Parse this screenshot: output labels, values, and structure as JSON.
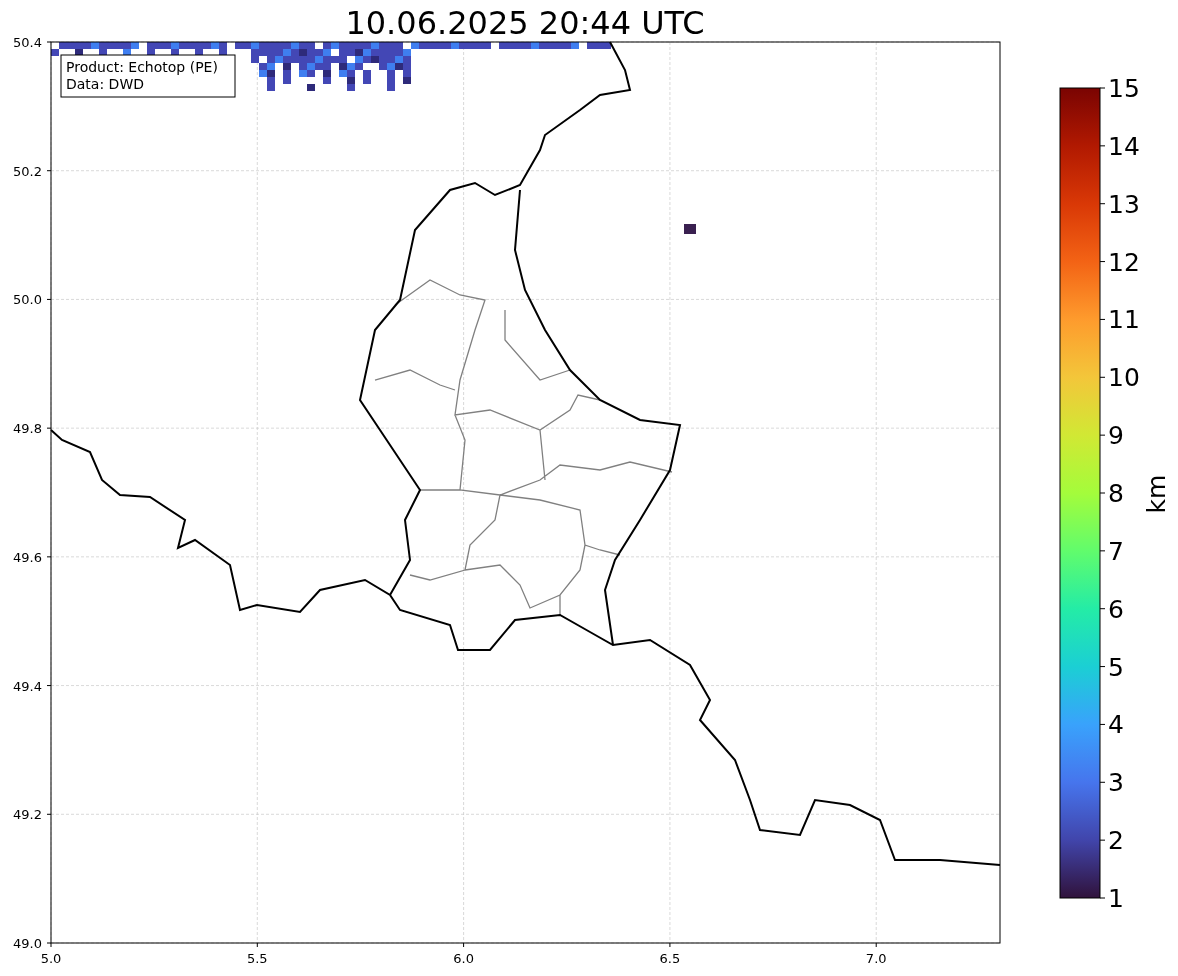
{
  "title": "10.06.2025 20:44 UTC",
  "legend": [
    "Product: Echotop (PE)",
    "Data: DWD"
  ],
  "x_ticks": [
    "5.0",
    "5.5",
    "6.0",
    "6.5",
    "7.0"
  ],
  "y_ticks": [
    "50.4",
    "50.2",
    "50.0",
    "49.8",
    "49.6",
    "49.4",
    "49.2",
    "49.0"
  ],
  "colorbar": {
    "label": "km",
    "ticks": [
      "15",
      "14",
      "13",
      "12",
      "11",
      "10",
      "9",
      "8",
      "7",
      "6",
      "5",
      "4",
      "3",
      "2",
      "1"
    ]
  }
}
